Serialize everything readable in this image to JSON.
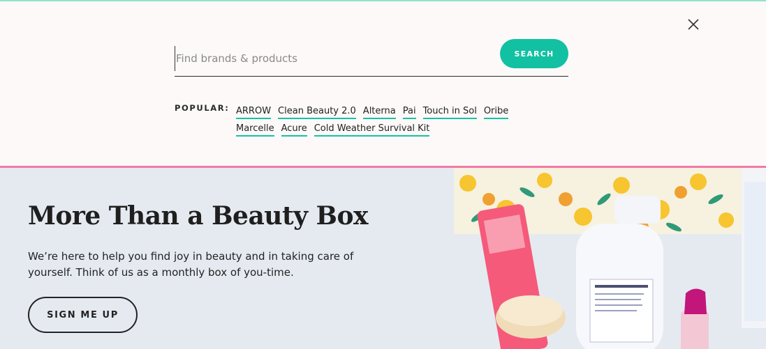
{
  "search": {
    "placeholder": "Find brands & products",
    "button_label": "SEARCH",
    "popular_label": "POPULAR:",
    "popular_links": [
      "ARROW",
      "Clean Beauty 2.0",
      "Alterna",
      "Pai",
      "Touch in Sol",
      "Oribe",
      "Marcelle",
      "Acure",
      "Cold Weather Survival Kit"
    ]
  },
  "hero": {
    "title": "More Than a Beauty Box",
    "copy": "We’re here to help you find joy in beauty and in taking care of yourself. Think of us as a monthly box of you-time.",
    "cta_label": "SIGN ME UP"
  },
  "colors": {
    "accent": "#12c0a2",
    "pink_divider": "#f27aa6",
    "panel_bg": "#fcf9f8",
    "hero_bg": "#e5eaf1"
  },
  "icons": {
    "close": "close-icon"
  }
}
